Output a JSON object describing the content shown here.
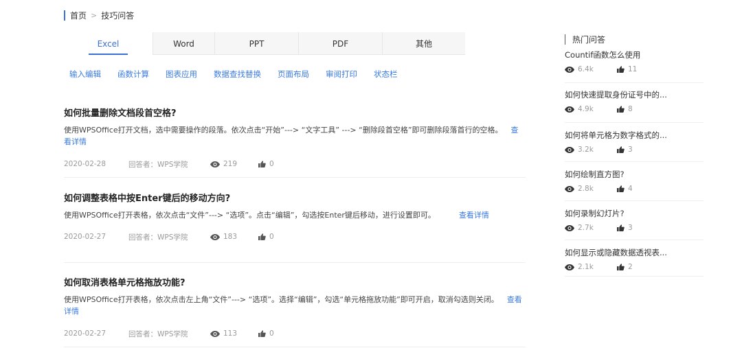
{
  "breadcrumb": {
    "home": "首页",
    "separator": ">",
    "current": "技巧问答"
  },
  "tabs": [
    {
      "label": "Excel",
      "active": true
    },
    {
      "label": "Word",
      "active": false
    },
    {
      "label": "PPT",
      "active": false
    },
    {
      "label": "PDF",
      "active": false
    },
    {
      "label": "其他",
      "active": false
    }
  ],
  "subtabs": [
    "输入编辑",
    "函数计算",
    "图表应用",
    "数据查找替换",
    "页面布局",
    "审阅打印",
    "状态栏"
  ],
  "articles": [
    {
      "title": "如何批量删除文档段首空格?",
      "summary": "使用WPSOffice打开文档，选中需要操作的段落。依次点击“开始”---> “文字工具” ---> “删除段首空格”即可删除段落首行的空格。",
      "more": "查看详情",
      "date": "2020-02-28",
      "author": "回答者：WPS学院",
      "views": "219",
      "likes": "0"
    },
    {
      "title": "如何调整表格中按Enter键后的移动方向?",
      "summary": "使用WPSOffice打开表格，依次点击“文件”---> “选项”。点击“编辑”，勾选按Enter键后移动，进行设置即可。",
      "more": "查看详情",
      "date": "2020-02-27",
      "author": "回答者：WPS学院",
      "views": "183",
      "likes": "0"
    },
    {
      "title": "如何取消表格单元格拖放功能?",
      "summary": "使用WPSOffice打开表格，依次点击左上角“文件”---> “选项”。选择“编辑”，勾选“单元格拖放功能”即可开启，取消勾选则关闭。",
      "more": "查看详情",
      "date": "2020-02-27",
      "author": "回答者：WPS学院",
      "views": "113",
      "likes": "0"
    }
  ],
  "sidebar": {
    "title": "热门问答",
    "items": [
      {
        "question": "Countif函数怎么使用",
        "views": "6.4k",
        "likes": "11"
      },
      {
        "question": "如何快速提取身份证号中的...",
        "views": "4.9k",
        "likes": "8"
      },
      {
        "question": "如何将单元格为数字格式的...",
        "views": "3.2k",
        "likes": "3"
      },
      {
        "question": "如何绘制直方图?",
        "views": "2.8k",
        "likes": "4"
      },
      {
        "question": "如何录制幻灯片?",
        "views": "2.7k",
        "likes": "3"
      },
      {
        "question": "如何显示或隐藏数据透视表...",
        "views": "2.1k",
        "likes": "2"
      }
    ]
  },
  "colors": {
    "accent": "#3a6fd8",
    "link": "#3a7be0",
    "muted": "#999999"
  },
  "icons": {
    "views": "eye-icon",
    "likes": "thumbs-up-icon"
  }
}
